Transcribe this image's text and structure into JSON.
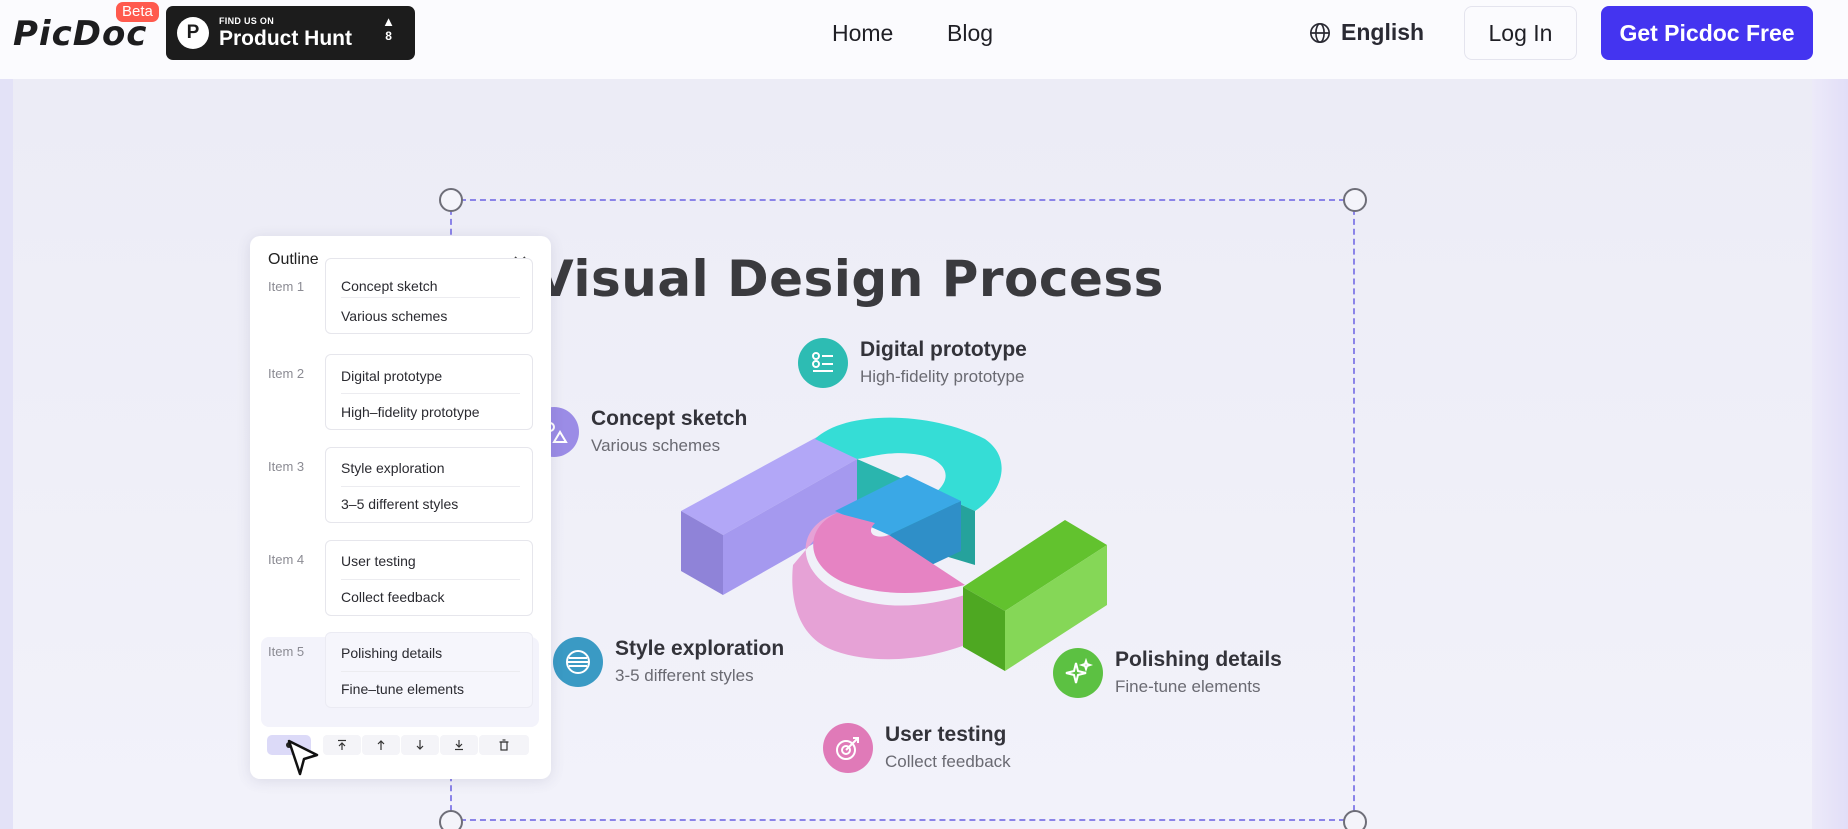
{
  "header": {
    "logo": "PicDoc",
    "beta_badge": "Beta",
    "product_hunt": {
      "small": "FIND US ON",
      "big": "Product Hunt",
      "votes": "8"
    },
    "nav": [
      "Home",
      "Blog"
    ],
    "language": "English",
    "login": "Log In",
    "cta": "Get Picdoc Free"
  },
  "canvas": {
    "title": "Visual Design Process",
    "steps": [
      {
        "title": "Digital prototype",
        "sub": "High-fidelity prototype",
        "color": "#2dbcb3",
        "icon": "list-icon"
      },
      {
        "title": "Concept sketch",
        "sub": "Various schemes",
        "color": "#9b8ce6",
        "icon": "sketch-icon"
      },
      {
        "title": "Style exploration",
        "sub": "3-5 different styles",
        "color": "#3a9ac4",
        "icon": "layers-icon"
      },
      {
        "title": "Polishing details",
        "sub": "Fine-tune elements",
        "color": "#5cc142",
        "icon": "sparkle-icon"
      },
      {
        "title": "User testing",
        "sub": "Collect feedback",
        "color": "#e07ab8",
        "icon": "target-icon"
      }
    ]
  },
  "outline": {
    "title": "Outline",
    "items": [
      {
        "label": "Item 1",
        "line1": "Concept sketch",
        "line2": "Various schemes"
      },
      {
        "label": "Item 2",
        "line1": "Digital prototype",
        "line2": "High–fidelity prototype"
      },
      {
        "label": "Item 3",
        "line1": "Style exploration",
        "line2": "3–5 different styles"
      },
      {
        "label": "Item 4",
        "line1": "User testing",
        "line2": "Collect feedback"
      },
      {
        "label": "Item 5",
        "line1": "Polishing details",
        "line2": "Fine–tune elements"
      }
    ],
    "toolbar_icons": [
      "drag-handle-icon",
      "move-top-icon",
      "move-up-icon",
      "move-down-icon",
      "move-bottom-icon",
      "delete-icon"
    ]
  },
  "colors": {
    "brand": "#4434f0",
    "selection": "#8b84e8",
    "beta": "#ff5a4e"
  }
}
